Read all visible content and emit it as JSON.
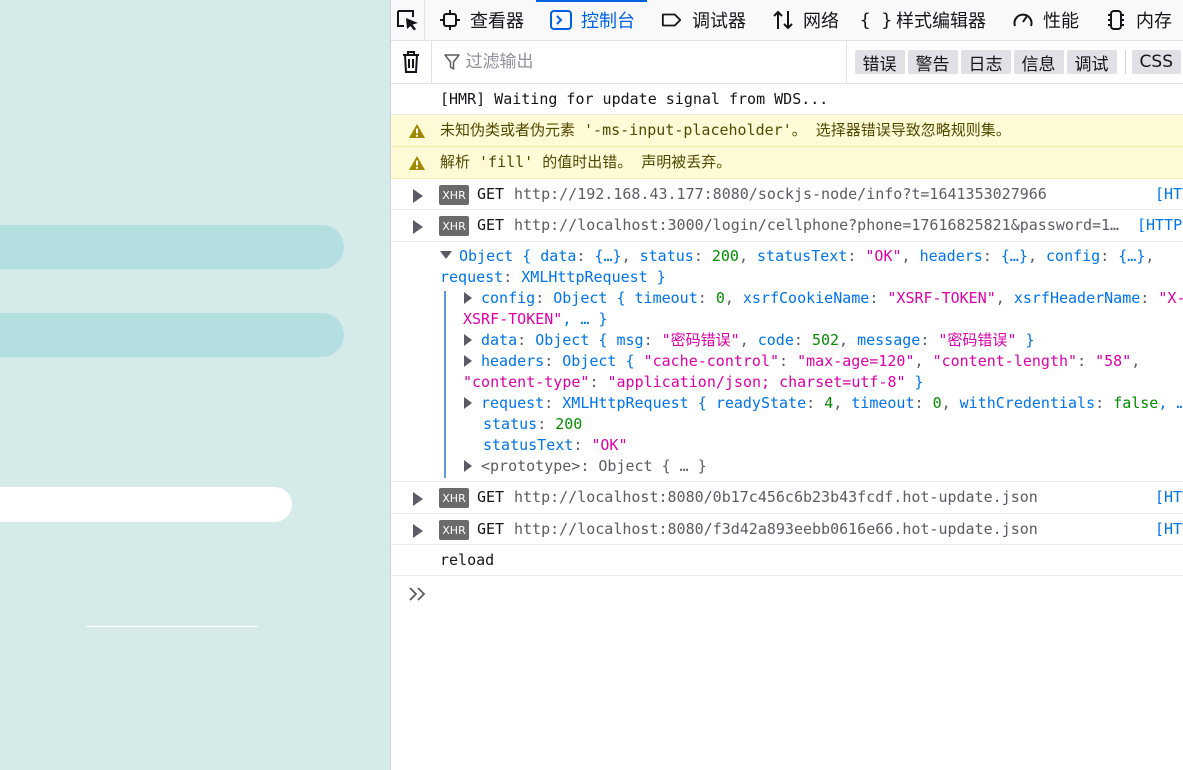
{
  "devtools": {
    "tabs": [
      {
        "label": "查看器",
        "icon": "inspector-icon"
      },
      {
        "label": "控制台",
        "icon": "console-icon",
        "active": true
      },
      {
        "label": "调试器",
        "icon": "debugger-icon"
      },
      {
        "label": "网络",
        "icon": "network-icon"
      },
      {
        "label": "样式编辑器",
        "icon": "style-editor-icon"
      },
      {
        "label": "性能",
        "icon": "performance-icon"
      },
      {
        "label": "内存",
        "icon": "memory-icon"
      }
    ],
    "filter": {
      "placeholder": "过滤输出"
    },
    "levels": [
      "错误",
      "警告",
      "日志",
      "信息",
      "调试"
    ],
    "css_button": "CSS"
  },
  "console": {
    "messages": {
      "hmr": "[HMR] Waiting for update signal from WDS...",
      "warn1": "未知伪类或者伪元素 '-ms-input-placeholder'。  选择器错误导致忽略规则集。",
      "warn2": "解析 'fill' 的值时出错。  声明被丢弃。",
      "xhr1": {
        "badge": "XHR",
        "method": "GET",
        "url": "http://192.168.43.177:8080/sockjs-node/info?t=1641353027966",
        "status": "[HTTP"
      },
      "xhr2": {
        "badge": "XHR",
        "method": "GET",
        "url": "http://localhost:3000/login/cellphone?phone=17616825821&password=1…",
        "status": "[HTTP/"
      },
      "xhr3": {
        "badge": "XHR",
        "method": "GET",
        "url": "http://localhost:8080/0b17c456c6b23b43fcdf.hot-update.json",
        "status": "[HTT"
      },
      "xhr4": {
        "badge": "XHR",
        "method": "GET",
        "url": "http://localhost:8080/f3d42a893eebb0616e66.hot-update.json",
        "status": "[HTT"
      },
      "reload": "reload"
    },
    "object": {
      "summary": {
        "head": "Object { ",
        "data_k": "data",
        "data_v": "{…}",
        "status_k": "status",
        "status_v": "200",
        "statusText_k": "statusText",
        "statusText_v": "\"OK\"",
        "headers_k": "headers",
        "headers_v": "{…}",
        "config_k": "config",
        "config_v": "{…}",
        "request_k": "request",
        "request_v": "XMLHttpRequest",
        "tail": " }"
      },
      "config": {
        "key": "config",
        "type": "Object { ",
        "timeout_k": "timeout",
        "timeout_v": "0",
        "xsrfCookieName_k": "xsrfCookieName",
        "xsrfCookieName_v": "\"XSRF-TOKEN\"",
        "xsrfHeaderName_k": "xsrfHeaderName",
        "xsrfHeaderName_v": "\"X-",
        "cont": "XSRF-TOKEN\"",
        "tail": ", … }"
      },
      "data": {
        "key": "data",
        "type": "Object { ",
        "msg_k": "msg",
        "msg_v": "\"密码错误\"",
        "code_k": "code",
        "code_v": "502",
        "message_k": "message",
        "message_v": "\"密码错误\"",
        "tail": " }"
      },
      "headers": {
        "key": "headers",
        "type": "Object { ",
        "cc_k": "\"cache-control\"",
        "cc_v": "\"max-age=120\"",
        "cl_k": "\"content-length\"",
        "cl_v": "\"58\"",
        "ct_k": "\"content-type\"",
        "ct_v": "\"application/json; charset=utf-8\"",
        "tail": " }"
      },
      "request": {
        "key": "request",
        "type": "XMLHttpRequest { ",
        "rs_k": "readyState",
        "rs_v": "4",
        "to_k": "timeout",
        "to_v": "0",
        "wc_k": "withCredentials",
        "wc_v": "false",
        "tail": ", …"
      },
      "status": {
        "key": "status",
        "value": "200"
      },
      "statusText": {
        "key": "statusText",
        "value": "\"OK\""
      },
      "prototype": {
        "key": "<prototype>",
        "value": "Object { … }"
      }
    }
  },
  "colors": {
    "accent": "#0061e0",
    "page_background": "#d5ebe9",
    "page_pill": "#b3dfe1",
    "warning_bg": "#fffbd6",
    "string": "#dd00a9",
    "number": "#058b00",
    "property": "#0074e8"
  }
}
